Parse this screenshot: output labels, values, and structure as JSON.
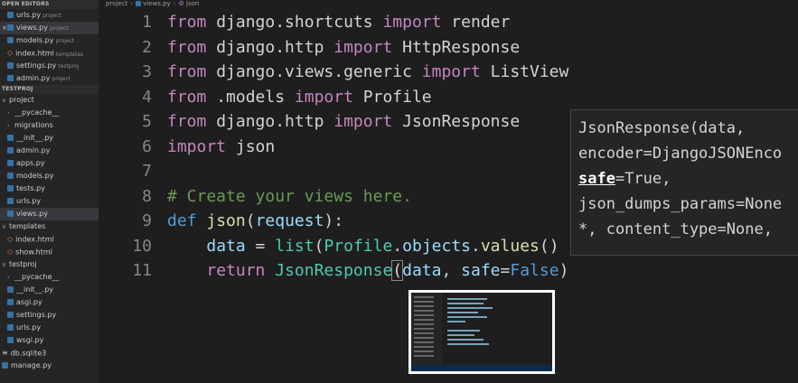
{
  "sidebar": {
    "open_editors_title": "OPEN EDITORS",
    "open_editors": [
      {
        "name": "urls.py",
        "folder": "project",
        "type": "py"
      },
      {
        "name": "views.py",
        "folder": "project",
        "type": "py"
      },
      {
        "name": "models.py",
        "folder": "project",
        "type": "py"
      },
      {
        "name": "index.html",
        "folder": "templates",
        "type": "html"
      },
      {
        "name": "settings.py",
        "folder": "testproj",
        "type": "py"
      },
      {
        "name": "admin.py",
        "folder": "project",
        "type": "py"
      }
    ],
    "project_title": "TESTPROJ",
    "tree": [
      {
        "name": "project",
        "kind": "folder",
        "indent": 0
      },
      {
        "name": "__pycache__",
        "kind": "folder-collapsed",
        "indent": 1
      },
      {
        "name": "migrations",
        "kind": "folder-collapsed",
        "indent": 1
      },
      {
        "name": "__init__.py",
        "kind": "py",
        "indent": 1
      },
      {
        "name": "admin.py",
        "kind": "py",
        "indent": 1
      },
      {
        "name": "apps.py",
        "kind": "py",
        "indent": 1
      },
      {
        "name": "models.py",
        "kind": "py",
        "indent": 1
      },
      {
        "name": "tests.py",
        "kind": "py",
        "indent": 1
      },
      {
        "name": "urls.py",
        "kind": "py",
        "indent": 1
      },
      {
        "name": "views.py",
        "kind": "py",
        "indent": 1,
        "active": true
      },
      {
        "name": "templates",
        "kind": "folder",
        "indent": 0
      },
      {
        "name": "index.html",
        "kind": "html",
        "indent": 1
      },
      {
        "name": "show.html",
        "kind": "html",
        "indent": 1
      },
      {
        "name": "testproj",
        "kind": "folder",
        "indent": 0
      },
      {
        "name": "__pycache__",
        "kind": "folder-collapsed",
        "indent": 1
      },
      {
        "name": "__init__.py",
        "kind": "py",
        "indent": 1
      },
      {
        "name": "asgi.py",
        "kind": "py",
        "indent": 1
      },
      {
        "name": "settings.py",
        "kind": "py",
        "indent": 1
      },
      {
        "name": "urls.py",
        "kind": "py",
        "indent": 1
      },
      {
        "name": "wsgi.py",
        "kind": "py",
        "indent": 1
      },
      {
        "name": "db.sqlite3",
        "kind": "db",
        "indent": 0
      },
      {
        "name": "manage.py",
        "kind": "py",
        "indent": 0
      }
    ]
  },
  "breadcrumb": [
    "project",
    "views.py",
    "json"
  ],
  "editor": {
    "lines": [
      {
        "n": "1",
        "tokens": [
          [
            "kw",
            "from"
          ],
          [
            "plain",
            " django.shortcuts "
          ],
          [
            "kw",
            "import"
          ],
          [
            "plain",
            " render"
          ]
        ]
      },
      {
        "n": "2",
        "tokens": [
          [
            "kw",
            "from"
          ],
          [
            "plain",
            " django.http "
          ],
          [
            "kw",
            "import"
          ],
          [
            "plain",
            " HttpResponse"
          ]
        ]
      },
      {
        "n": "3",
        "tokens": [
          [
            "kw",
            "from"
          ],
          [
            "plain",
            " django.views.generic "
          ],
          [
            "kw",
            "import"
          ],
          [
            "plain",
            " ListView"
          ]
        ]
      },
      {
        "n": "4",
        "tokens": [
          [
            "kw",
            "from"
          ],
          [
            "plain",
            " .models "
          ],
          [
            "kw",
            "import"
          ],
          [
            "plain",
            " Profile"
          ]
        ]
      },
      {
        "n": "5",
        "tokens": [
          [
            "kw",
            "from"
          ],
          [
            "plain",
            " django.http "
          ],
          [
            "kw",
            "import"
          ],
          [
            "plain",
            " JsonResponse"
          ]
        ]
      },
      {
        "n": "6",
        "tokens": [
          [
            "kw",
            "import"
          ],
          [
            "plain",
            " json"
          ]
        ]
      },
      {
        "n": "7",
        "tokens": []
      },
      {
        "n": "8",
        "tokens": [
          [
            "cm",
            "# Create your views here."
          ]
        ]
      },
      {
        "n": "9",
        "tokens": [
          [
            "kw2",
            "def"
          ],
          [
            "plain",
            " "
          ],
          [
            "fn",
            "json"
          ],
          [
            "plain",
            "("
          ],
          [
            "var",
            "request"
          ],
          [
            "plain",
            "):"
          ]
        ]
      },
      {
        "n": "10",
        "tokens": [
          [
            "plain",
            "    "
          ],
          [
            "var",
            "data"
          ],
          [
            "plain",
            " = "
          ],
          [
            "cls",
            "list"
          ],
          [
            "plain",
            "("
          ],
          [
            "cls",
            "Profile"
          ],
          [
            "plain",
            "."
          ],
          [
            "var",
            "objects"
          ],
          [
            "plain",
            "."
          ],
          [
            "fn",
            "values"
          ],
          [
            "plain",
            "()"
          ]
        ]
      },
      {
        "n": "11",
        "tokens": [
          [
            "plain",
            "    "
          ],
          [
            "kw",
            "return"
          ],
          [
            "plain",
            " "
          ],
          [
            "cls",
            "JsonResponse"
          ],
          [
            "plain",
            "("
          ],
          [
            "var",
            "data"
          ],
          [
            "plain",
            ", "
          ],
          [
            "var",
            "safe"
          ],
          [
            "plain",
            "="
          ],
          [
            "bool",
            "False"
          ],
          [
            "plain",
            ")"
          ]
        ]
      }
    ]
  },
  "tooltip": {
    "lines": [
      {
        "parts": [
          [
            "n",
            "JsonResponse(data,"
          ]
        ]
      },
      {
        "parts": [
          [
            "n",
            "encoder=DjangoJSONEnco"
          ]
        ]
      },
      {
        "parts": [
          [
            "b",
            "safe"
          ],
          [
            "n",
            "=True,"
          ]
        ]
      },
      {
        "parts": [
          [
            "n",
            "json_dumps_params=None"
          ]
        ]
      },
      {
        "parts": [
          [
            "n",
            "*, content_type=None,"
          ]
        ]
      }
    ]
  },
  "colors": {
    "background": "#1e1e1e",
    "sidebar": "#252526",
    "keyword": "#c586c0",
    "comment": "#6a9955",
    "class": "#4ec9b0",
    "variable": "#9cdcfe"
  }
}
